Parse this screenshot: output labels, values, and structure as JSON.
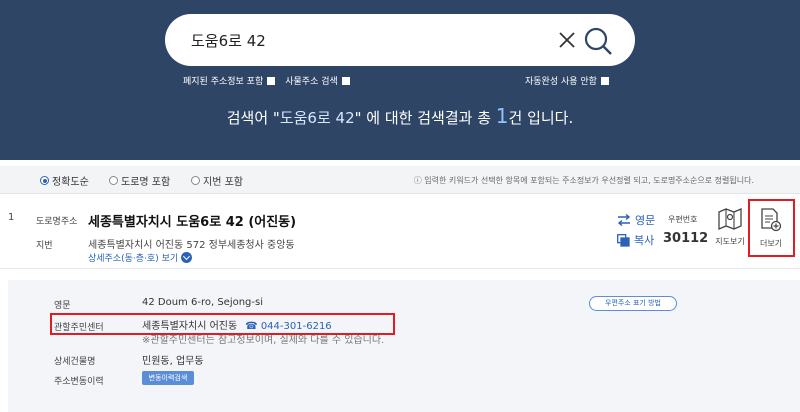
{
  "search": {
    "value": "도움6로 42"
  },
  "options": {
    "abolished": "폐지된 주소정보 포함",
    "thing_addr": "사물주소 검색",
    "autocomplete_off": "자동완성 사용 안함"
  },
  "summary": {
    "prefix": "검색어 \"",
    "keyword": "도움6로 42",
    "middle": "\" 에 대한 검색결과 총 ",
    "count": "1",
    "suffix": "건 입니다."
  },
  "filters": {
    "items": [
      "정확도순",
      "도로명 포함",
      "지번 포함"
    ],
    "selected": "정확도순",
    "notice": "ⓘ 입력한 키워드가 선택한 항목에 포함되는 주소정보가 우선정렬 되고, 도로명주소순으로 정렬됩니다."
  },
  "result": {
    "index": "1",
    "road_label": "도로명주소",
    "road_address": "세종특별자치시 도움6로 42 (어진동)",
    "jibun_label": "지번",
    "jibun_address": "세종특별자치시 어진동 572 정부세종청사 중앙동",
    "detail_link": "상세주소(동·층·호) 보기",
    "eng_label": "영문",
    "copy_label": "복사",
    "zip_label": "우편번호",
    "zip_code": "30112",
    "map_label": "지도보기",
    "more_label": "더보기"
  },
  "detail": {
    "eng_label": "영문",
    "eng_value": "42 Doum 6-ro, Sejong-si",
    "center_label": "관할주민센터",
    "center_value": "세종특별자치시 어진동",
    "phone": "☎ 044-301-6216",
    "note": "※관할주민센터는 참고정보이며, 실제와 다를 수 있습니다.",
    "building_label": "상세건물명",
    "building_value": "민원동, 업무동",
    "history_label": "주소변동이력",
    "history_button": "변동이력검색",
    "zip_method_button": "우편주소 표기 방법"
  },
  "colors": {
    "hero": "#2f4566",
    "accent": "#2b62b8",
    "highlight": "#e31b23"
  }
}
